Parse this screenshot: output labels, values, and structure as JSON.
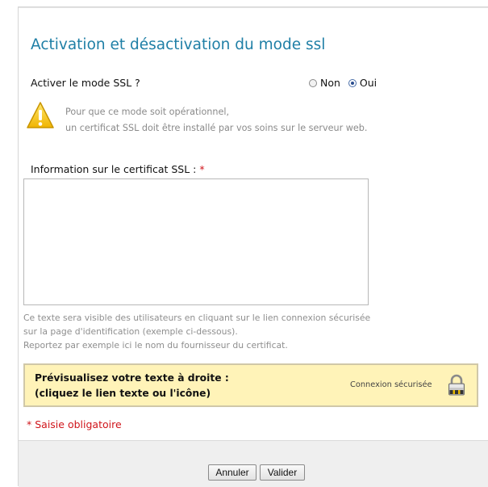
{
  "title": "Activation et désactivation du mode ssl",
  "ssl_mode": {
    "label": "Activer le mode SSL ?",
    "options": [
      {
        "label": "Non",
        "checked": false
      },
      {
        "label": "Oui",
        "checked": true
      }
    ]
  },
  "warning": {
    "icon": "warning-icon",
    "line1": "Pour que ce mode soit opérationnel,",
    "line2": "un certificat SSL doit être installé par vos soins sur le serveur web."
  },
  "certificate": {
    "label": "Information sur le certificat SSL : ",
    "required_mark": "*",
    "value": ""
  },
  "help": {
    "line1": "Ce texte sera visible des utilisateurs en cliquant sur le lien connexion sécurisée",
    "line2": "sur la page d'identification (exemple ci-dessous).",
    "line3": "Reportez par exemple ici le nom du fournisseur du certificat."
  },
  "preview": {
    "line1": "Prévisualisez votre texte à droite :",
    "line2": "(cliquez le lien texte ou l'icône)",
    "link_text": "Connexion sécurisée",
    "icon": "lock-icon"
  },
  "required_note": "* Saisie obligatoire",
  "buttons": {
    "cancel": "Annuler",
    "validate": "Valider"
  },
  "colors": {
    "title": "#1f7fa6",
    "required": "#d0151b",
    "preview_background": "#fff3b8"
  }
}
